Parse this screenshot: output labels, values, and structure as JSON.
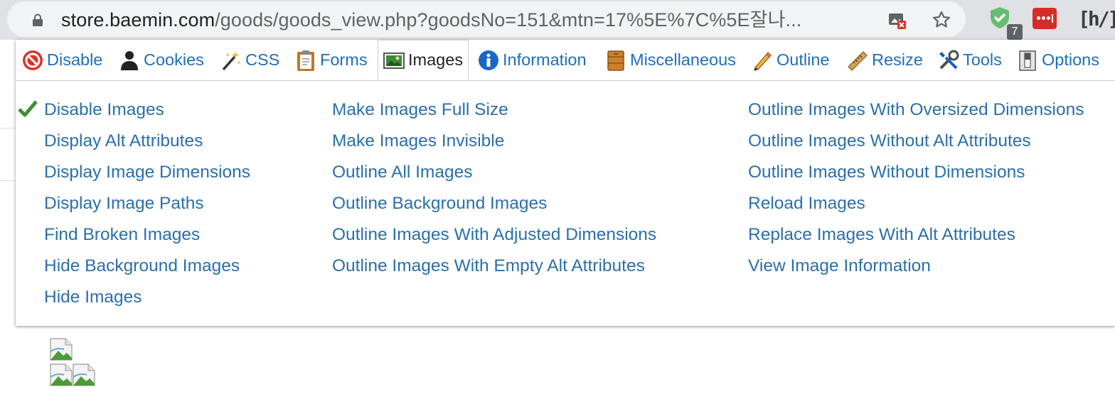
{
  "browser": {
    "url_host": "store.baemin.com",
    "url_path": "/goods/goods_view.php?goodsNo=151&mtn=17%5E%7C%5E잘나...",
    "extension_badge": "7"
  },
  "toolbar": {
    "tabs": [
      {
        "label": "Disable",
        "icon": "no-entry-icon"
      },
      {
        "label": "Cookies",
        "icon": "cookie-person-icon"
      },
      {
        "label": "CSS",
        "icon": "magic-wand-icon"
      },
      {
        "label": "Forms",
        "icon": "clipboard-icon"
      },
      {
        "label": "Images",
        "icon": "picture-icon",
        "active": true
      },
      {
        "label": "Information",
        "icon": "info-icon"
      },
      {
        "label": "Miscellaneous",
        "icon": "box-icon"
      },
      {
        "label": "Outline",
        "icon": "pencil-icon"
      },
      {
        "label": "Resize",
        "icon": "ruler-icon"
      },
      {
        "label": "Tools",
        "icon": "tools-icon"
      },
      {
        "label": "Options",
        "icon": "switch-icon"
      }
    ]
  },
  "images_menu": {
    "col1": [
      {
        "label": "Disable Images",
        "checked": true
      },
      {
        "label": "Display Alt Attributes"
      },
      {
        "label": "Display Image Dimensions"
      },
      {
        "label": "Display Image Paths"
      },
      {
        "label": "Find Broken Images"
      },
      {
        "label": "Hide Background Images"
      },
      {
        "label": "Hide Images"
      }
    ],
    "col2": [
      {
        "label": "Make Images Full Size"
      },
      {
        "label": "Make Images Invisible"
      },
      {
        "label": "Outline All Images"
      },
      {
        "label": "Outline Background Images"
      },
      {
        "label": "Outline Images With Adjusted Dimensions"
      },
      {
        "label": "Outline Images With Empty Alt Attributes"
      }
    ],
    "col3": [
      {
        "label": "Outline Images With Oversized Dimensions"
      },
      {
        "label": "Outline Images Without Alt Attributes"
      },
      {
        "label": "Outline Images Without Dimensions"
      },
      {
        "label": "Reload Images"
      },
      {
        "label": "Replace Images With Alt Attributes"
      },
      {
        "label": "View Image Information"
      }
    ]
  },
  "colors": {
    "link": "#2a6fae",
    "tab_link": "#1d6ec0"
  }
}
